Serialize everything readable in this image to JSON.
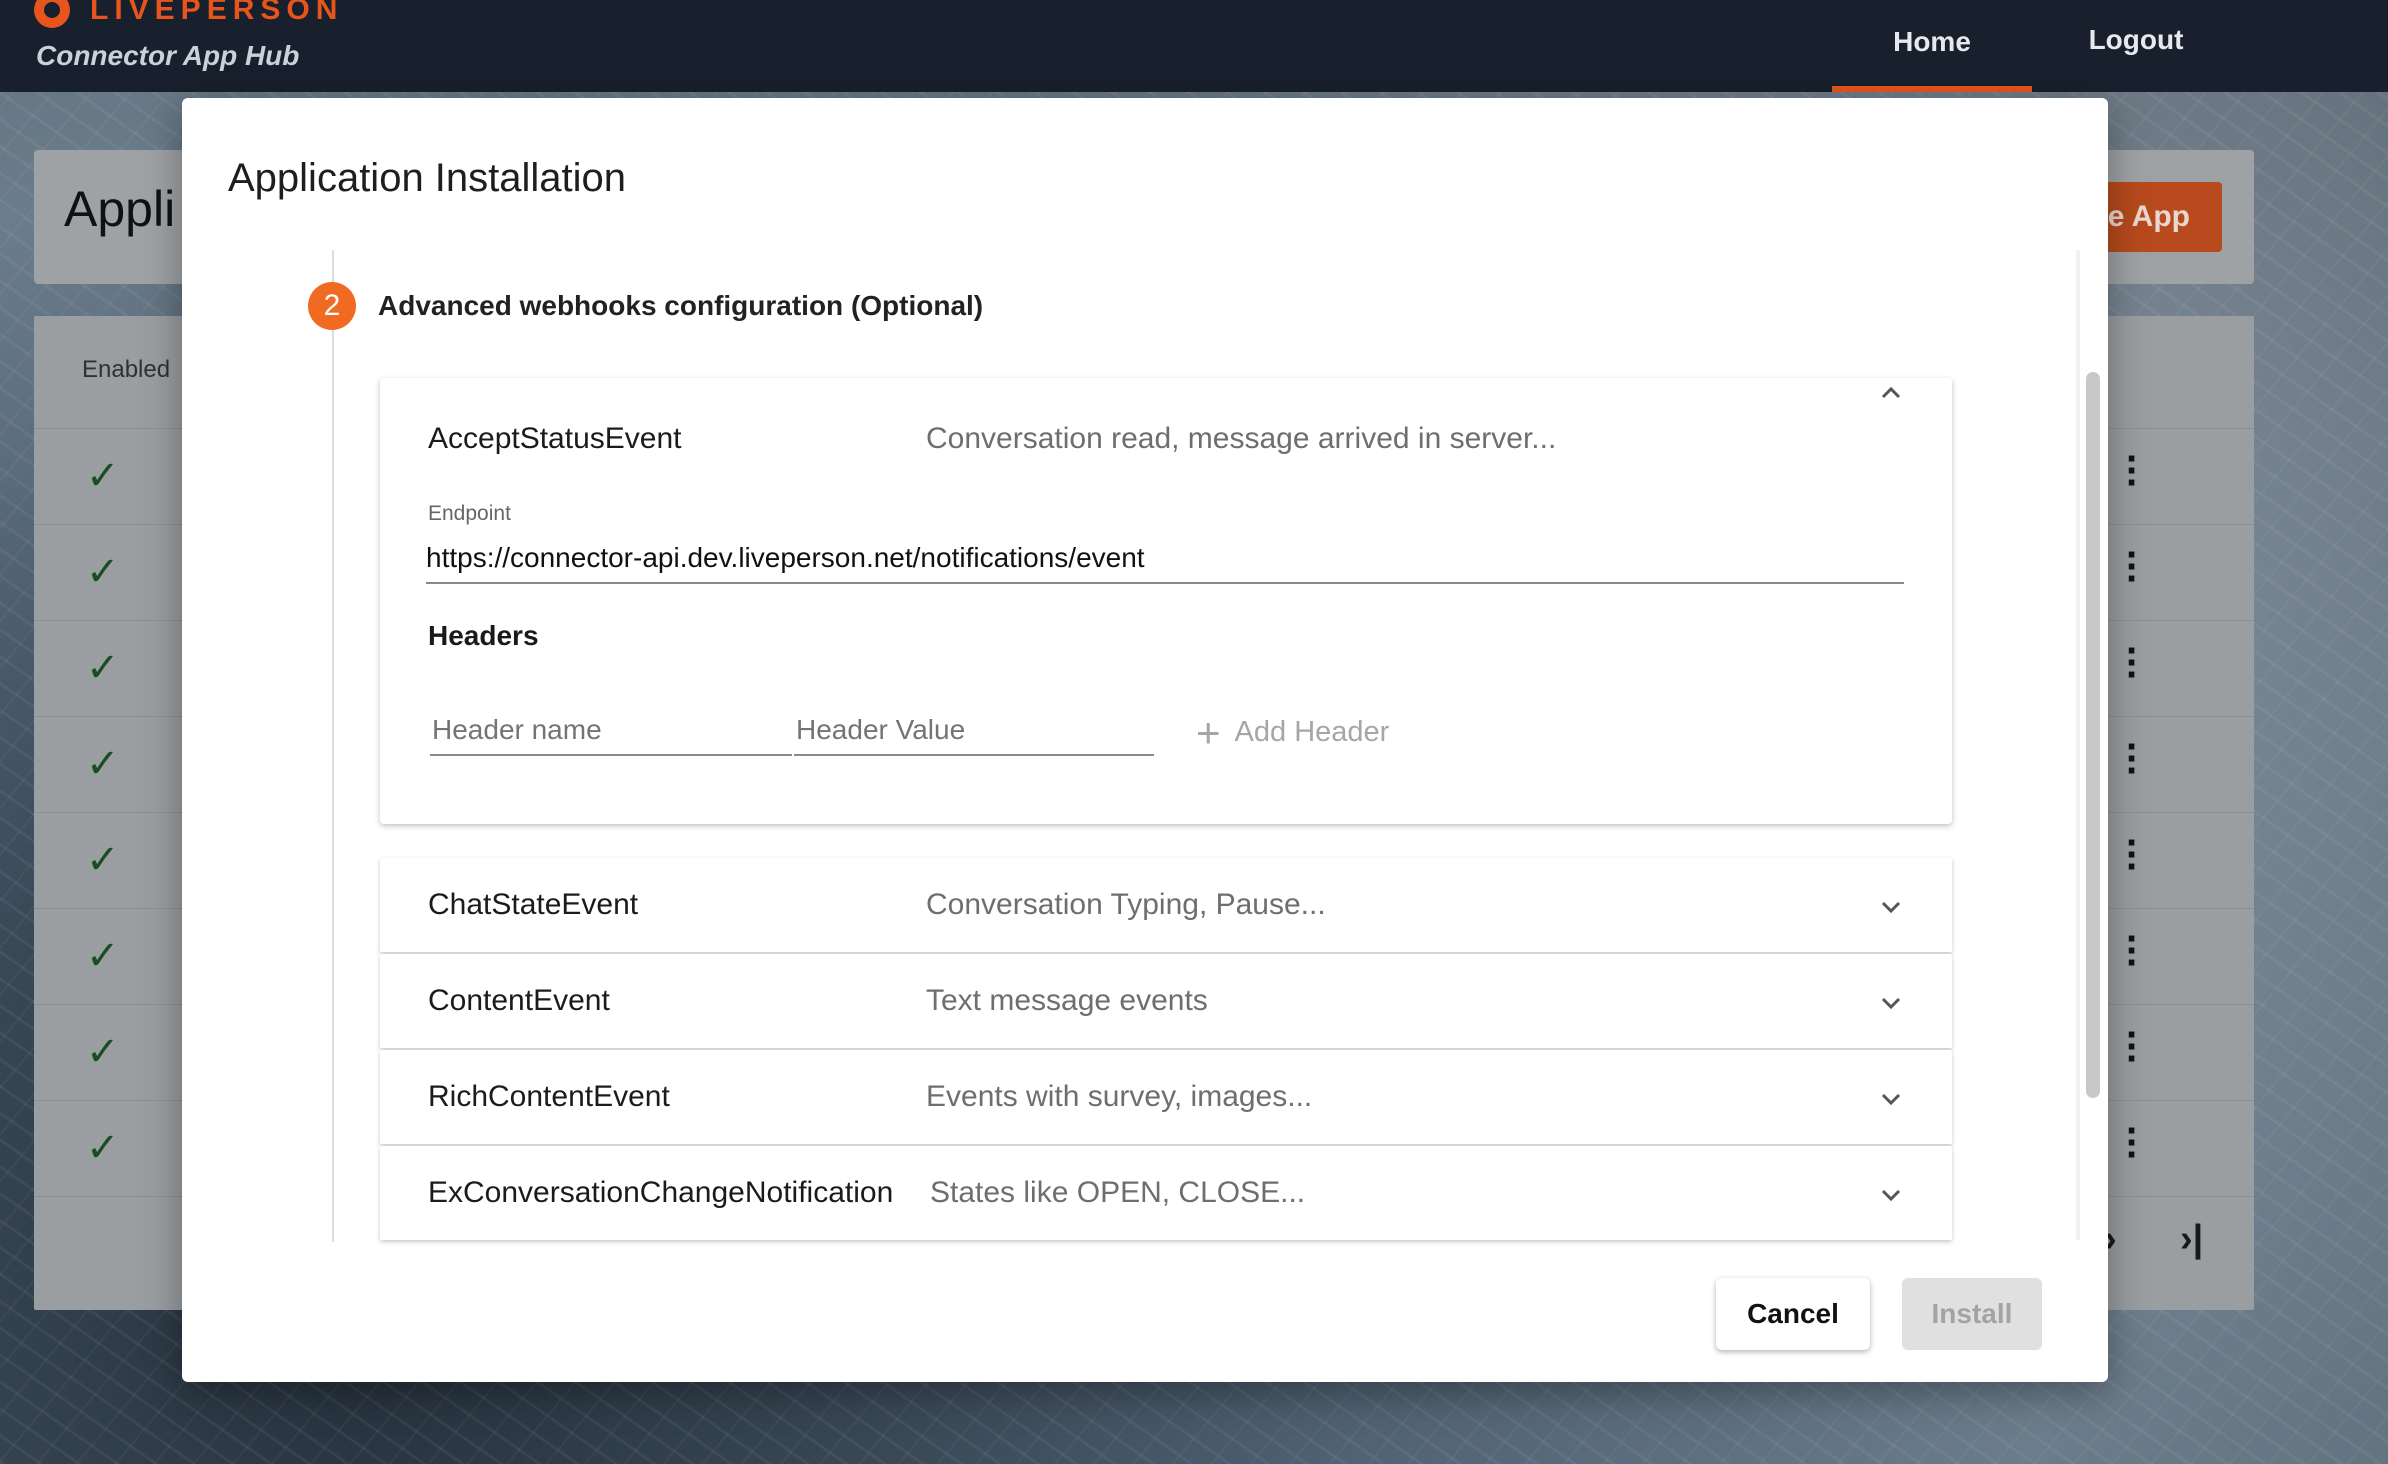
{
  "header": {
    "brand": "LIVEPERSON",
    "app_name": "Connector App Hub",
    "nav": {
      "home": "Home",
      "logout": "Logout"
    }
  },
  "background_page": {
    "title": "Appli",
    "create_button": "te App",
    "table": {
      "enabled_header": "Enabled"
    }
  },
  "modal": {
    "title": "Application Installation",
    "step": {
      "number": "2",
      "label": "Advanced webhooks configuration (Optional)"
    },
    "expanded_event": {
      "name": "AcceptStatusEvent",
      "description": "Conversation read, message arrived in server...",
      "endpoint_label": "Endpoint",
      "endpoint_value": "https://connector-api.dev.liveperson.net/notifications/event",
      "headers_label": "Headers",
      "header_name_placeholder": "Header name",
      "header_value_placeholder": "Header Value",
      "add_header_label": "Add Header"
    },
    "events": [
      {
        "name": "ChatStateEvent",
        "description": "Conversation Typing, Pause..."
      },
      {
        "name": "ContentEvent",
        "description": "Text message events"
      },
      {
        "name": "RichContentEvent",
        "description": "Events with survey, images..."
      },
      {
        "name": "ExConversationChangeNotification",
        "description": "States like OPEN, CLOSE..."
      }
    ],
    "buttons": {
      "cancel": "Cancel",
      "install": "Install"
    }
  },
  "colors": {
    "accent": "#e8551c",
    "step": "#f16a21",
    "topbar": "#17202c"
  },
  "icons": [
    "logo-icon",
    "check-icon",
    "kebab-menu-icon",
    "chevron-up-icon",
    "chevron-down-icon",
    "plus-icon",
    "next-page-icon",
    "last-page-icon"
  ]
}
